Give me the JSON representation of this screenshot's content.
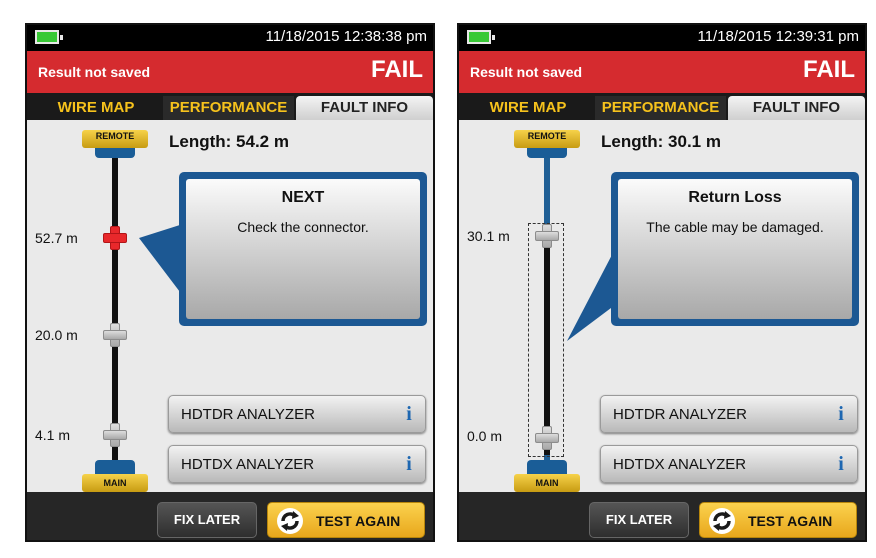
{
  "panels": [
    {
      "datetime": "11/18/2015 12:38:38 pm",
      "result_note": "Result not saved",
      "result_status": "FAIL",
      "tabs": [
        "WIRE MAP",
        "PERFORMANCE",
        "FAULT INFO"
      ],
      "length": "Length:  54.2 m",
      "remote_label": "REMOTE",
      "main_label": "MAIN",
      "distances": [
        "52.7 m",
        "20.0 m",
        "4.1 m"
      ],
      "fault": {
        "title": "NEXT",
        "message": "Check the connector."
      },
      "analyzers": [
        "HDTDR ANALYZER",
        "HDTDX ANALYZER"
      ],
      "info_glyph": "i",
      "fix_later": "FIX LATER",
      "test_again": "TEST AGAIN"
    },
    {
      "datetime": "11/18/2015 12:39:31 pm",
      "result_note": "Result not saved",
      "result_status": "FAIL",
      "tabs": [
        "WIRE MAP",
        "PERFORMANCE",
        "FAULT INFO"
      ],
      "length": "Length:  30.1 m",
      "remote_label": "REMOTE",
      "main_label": "MAIN",
      "distances": [
        "30.1 m",
        "0.0 m"
      ],
      "fault": {
        "title": "Return Loss",
        "message": "The cable may be damaged."
      },
      "analyzers": [
        "HDTDR ANALYZER",
        "HDTDX ANALYZER"
      ],
      "info_glyph": "i",
      "fix_later": "FIX LATER",
      "test_again": "TEST AGAIN"
    }
  ],
  "colors": {
    "fail_red": "#d52b2f",
    "tab_yellow": "#f6c21c",
    "callout_blue": "#1c5893",
    "button_yellow": "#f2bf35",
    "battery_green": "#38c936"
  }
}
